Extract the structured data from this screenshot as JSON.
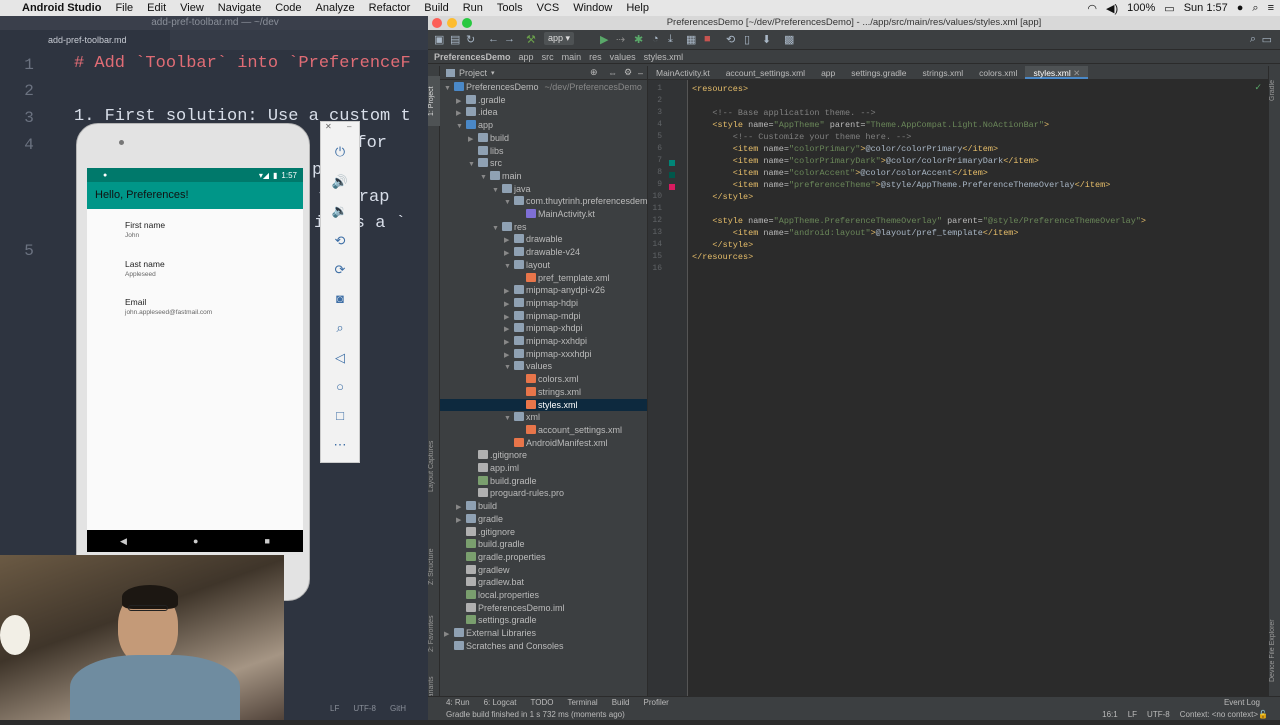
{
  "menubar": {
    "app_name": "Android Studio",
    "items": [
      "File",
      "Edit",
      "View",
      "Navigate",
      "Code",
      "Analyze",
      "Refactor",
      "Build",
      "Run",
      "Tools",
      "VCS",
      "Window",
      "Help"
    ],
    "battery": "100%",
    "clock": "Sun 1:57"
  },
  "md_editor": {
    "window_title": "add-pref-toolbar.md — ~/dev",
    "tab_label": "add-pref-toolbar.md",
    "lines": [
      {
        "num": "1",
        "text": "# Add `Toolbar` into `PreferenceF"
      },
      {
        "num": "2",
        "text": ""
      },
      {
        "num": "3",
        "text": "1. First solution: Use a custom t"
      },
      {
        "num": "4",
        "text": "a for"
      },
      {
        "num": "",
        "text": "p."
      },
      {
        "num": "",
        "text": "t: Wrap"
      },
      {
        "num": "",
        "text": "i has a `"
      },
      {
        "num": "5",
        "text": ""
      }
    ]
  },
  "emulator": {
    "status_time": "1:57",
    "app_title": "Hello, Preferences!",
    "prefs": [
      {
        "title": "First name",
        "summary": "John"
      },
      {
        "title": "Last name",
        "summary": "Appleseed"
      },
      {
        "title": "Email",
        "summary": "john.appleseed@fastmail.com"
      }
    ],
    "toolbar_icons": [
      "power-icon",
      "volume-up-icon",
      "volume-down-icon",
      "rotate-left-icon",
      "rotate-right-icon",
      "camera-icon",
      "zoom-icon",
      "back-icon",
      "home-icon",
      "overview-icon",
      "more-icon"
    ]
  },
  "studio": {
    "window_title": "PreferencesDemo [~/dev/PreferencesDemo] - .../app/src/main/res/values/styles.xml [app]",
    "run_config": "app",
    "breadcrumbs": [
      "PreferencesDemo",
      "app",
      "src",
      "main",
      "res",
      "values",
      "styles.xml"
    ],
    "project_view": "Project",
    "tree": [
      {
        "label": "PreferencesDemo",
        "hint": "~/dev/PreferencesDemo",
        "depth": 0,
        "arrow": "▼",
        "icon": "module"
      },
      {
        "label": ".gradle",
        "depth": 1,
        "arrow": "▶",
        "icon": "folder"
      },
      {
        "label": ".idea",
        "depth": 1,
        "arrow": "▶",
        "icon": "folder"
      },
      {
        "label": "app",
        "depth": 1,
        "arrow": "▼",
        "icon": "module"
      },
      {
        "label": "build",
        "depth": 2,
        "arrow": "▶",
        "icon": "folder"
      },
      {
        "label": "libs",
        "depth": 2,
        "arrow": "",
        "icon": "folder"
      },
      {
        "label": "src",
        "depth": 2,
        "arrow": "▼",
        "icon": "folder"
      },
      {
        "label": "main",
        "depth": 3,
        "arrow": "▼",
        "icon": "folder"
      },
      {
        "label": "java",
        "depth": 4,
        "arrow": "▼",
        "icon": "folder"
      },
      {
        "label": "com.thuytrinh.preferencesdem",
        "depth": 5,
        "arrow": "▼",
        "icon": "folder"
      },
      {
        "label": "MainActivity.kt",
        "depth": 6,
        "arrow": "",
        "icon": "kt"
      },
      {
        "label": "res",
        "depth": 4,
        "arrow": "▼",
        "icon": "folder"
      },
      {
        "label": "drawable",
        "depth": 5,
        "arrow": "▶",
        "icon": "folder"
      },
      {
        "label": "drawable-v24",
        "depth": 5,
        "arrow": "▶",
        "icon": "folder"
      },
      {
        "label": "layout",
        "depth": 5,
        "arrow": "▼",
        "icon": "folder"
      },
      {
        "label": "pref_template.xml",
        "depth": 6,
        "arrow": "",
        "icon": "xml"
      },
      {
        "label": "mipmap-anydpi-v26",
        "depth": 5,
        "arrow": "▶",
        "icon": "folder"
      },
      {
        "label": "mipmap-hdpi",
        "depth": 5,
        "arrow": "▶",
        "icon": "folder"
      },
      {
        "label": "mipmap-mdpi",
        "depth": 5,
        "arrow": "▶",
        "icon": "folder"
      },
      {
        "label": "mipmap-xhdpi",
        "depth": 5,
        "arrow": "▶",
        "icon": "folder"
      },
      {
        "label": "mipmap-xxhdpi",
        "depth": 5,
        "arrow": "▶",
        "icon": "folder"
      },
      {
        "label": "mipmap-xxxhdpi",
        "depth": 5,
        "arrow": "▶",
        "icon": "folder"
      },
      {
        "label": "values",
        "depth": 5,
        "arrow": "▼",
        "icon": "folder"
      },
      {
        "label": "colors.xml",
        "depth": 6,
        "arrow": "",
        "icon": "xml"
      },
      {
        "label": "strings.xml",
        "depth": 6,
        "arrow": "",
        "icon": "xml"
      },
      {
        "label": "styles.xml",
        "depth": 6,
        "arrow": "",
        "icon": "xml",
        "selected": true
      },
      {
        "label": "xml",
        "depth": 5,
        "arrow": "▼",
        "icon": "folder"
      },
      {
        "label": "account_settings.xml",
        "depth": 6,
        "arrow": "",
        "icon": "xml"
      },
      {
        "label": "AndroidManifest.xml",
        "depth": 5,
        "arrow": "",
        "icon": "xml"
      },
      {
        "label": ".gitignore",
        "depth": 2,
        "arrow": "",
        "icon": "file"
      },
      {
        "label": "app.iml",
        "depth": 2,
        "arrow": "",
        "icon": "file"
      },
      {
        "label": "build.gradle",
        "depth": 2,
        "arrow": "",
        "icon": "gradle"
      },
      {
        "label": "proguard-rules.pro",
        "depth": 2,
        "arrow": "",
        "icon": "file"
      },
      {
        "label": "build",
        "depth": 1,
        "arrow": "▶",
        "icon": "folder"
      },
      {
        "label": "gradle",
        "depth": 1,
        "arrow": "▶",
        "icon": "folder"
      },
      {
        "label": ".gitignore",
        "depth": 1,
        "arrow": "",
        "icon": "file"
      },
      {
        "label": "build.gradle",
        "depth": 1,
        "arrow": "",
        "icon": "gradle"
      },
      {
        "label": "gradle.properties",
        "depth": 1,
        "arrow": "",
        "icon": "gradle"
      },
      {
        "label": "gradlew",
        "depth": 1,
        "arrow": "",
        "icon": "file"
      },
      {
        "label": "gradlew.bat",
        "depth": 1,
        "arrow": "",
        "icon": "file"
      },
      {
        "label": "local.properties",
        "depth": 1,
        "arrow": "",
        "icon": "gradle"
      },
      {
        "label": "PreferencesDemo.iml",
        "depth": 1,
        "arrow": "",
        "icon": "file"
      },
      {
        "label": "settings.gradle",
        "depth": 1,
        "arrow": "",
        "icon": "gradle"
      },
      {
        "label": "External Libraries",
        "depth": 0,
        "arrow": "▶",
        "icon": "folder"
      },
      {
        "label": "Scratches and Consoles",
        "depth": 0,
        "arrow": "",
        "icon": "folder"
      }
    ],
    "editor_tabs": [
      {
        "label": "MainActivity.kt"
      },
      {
        "label": "account_settings.xml"
      },
      {
        "label": "app"
      },
      {
        "label": "settings.gradle"
      },
      {
        "label": "strings.xml"
      },
      {
        "label": "colors.xml"
      },
      {
        "label": "styles.xml",
        "active": true
      }
    ],
    "code": [
      {
        "n": "1",
        "parts": [
          [
            "tag",
            "<resources>"
          ]
        ]
      },
      {
        "n": "2",
        "parts": []
      },
      {
        "n": "3",
        "parts": [
          [
            "cmt",
            "    <!-- Base application theme. -->"
          ]
        ]
      },
      {
        "n": "4",
        "parts": [
          [
            "tag",
            "    <style "
          ],
          [
            "attr",
            "name="
          ],
          [
            "val",
            "\"AppTheme\" "
          ],
          [
            "attr",
            "parent="
          ],
          [
            "val",
            "\"Theme.AppCompat.Light.NoActionBar\""
          ],
          [
            "tag",
            ">"
          ]
        ]
      },
      {
        "n": "5",
        "parts": [
          [
            "cmt",
            "        <!-- Customize your theme here. -->"
          ]
        ]
      },
      {
        "n": "6",
        "parts": [
          [
            "tag",
            "        <item "
          ],
          [
            "attr",
            "name="
          ],
          [
            "val",
            "\"colorPrimary\""
          ],
          [
            "tag",
            ">"
          ],
          [
            "txt",
            "@color/colorPrimary"
          ],
          [
            "tag",
            "</item>"
          ]
        ]
      },
      {
        "n": "7",
        "parts": [
          [
            "tag",
            "        <item "
          ],
          [
            "attr",
            "name="
          ],
          [
            "val",
            "\"colorPrimaryDark\""
          ],
          [
            "tag",
            ">"
          ],
          [
            "txt",
            "@color/colorPrimaryDark"
          ],
          [
            "tag",
            "</item>"
          ]
        ]
      },
      {
        "n": "8",
        "parts": [
          [
            "tag",
            "        <item "
          ],
          [
            "attr",
            "name="
          ],
          [
            "val",
            "\"colorAccent\""
          ],
          [
            "tag",
            ">"
          ],
          [
            "txt",
            "@color/colorAccent"
          ],
          [
            "tag",
            "</item>"
          ]
        ]
      },
      {
        "n": "9",
        "parts": [
          [
            "tag",
            "        <item "
          ],
          [
            "attr",
            "name="
          ],
          [
            "val",
            "\"preferenceTheme\""
          ],
          [
            "tag",
            ">"
          ],
          [
            "txt",
            "@style/AppTheme.PreferenceThemeOverlay"
          ],
          [
            "tag",
            "</item>"
          ]
        ]
      },
      {
        "n": "10",
        "parts": [
          [
            "tag",
            "    </style>"
          ]
        ]
      },
      {
        "n": "11",
        "parts": []
      },
      {
        "n": "12",
        "parts": [
          [
            "tag",
            "    <style "
          ],
          [
            "attr",
            "name="
          ],
          [
            "val",
            "\"AppTheme.PreferenceThemeOverlay\" "
          ],
          [
            "attr",
            "parent="
          ],
          [
            "val",
            "\"@style/PreferenceThemeOverlay\""
          ],
          [
            "tag",
            ">"
          ]
        ]
      },
      {
        "n": "13",
        "parts": [
          [
            "tag",
            "        <item "
          ],
          [
            "attr",
            "name="
          ],
          [
            "val",
            "\"android:layout\""
          ],
          [
            "tag",
            ">"
          ],
          [
            "txt",
            "@layout/pref_template"
          ],
          [
            "tag",
            "</item>"
          ]
        ]
      },
      {
        "n": "14",
        "parts": [
          [
            "tag",
            "    </style>"
          ]
        ]
      },
      {
        "n": "15",
        "parts": [
          [
            "tag",
            "</resources>"
          ]
        ]
      },
      {
        "n": "16",
        "parts": []
      }
    ],
    "left_tool_tabs": [
      "1: Project",
      "Layout Captures",
      "Z: Structure",
      "2: Favorites",
      "Build Variants"
    ],
    "bottom_tabs": [
      "4: Run",
      "6: Logcat",
      "TODO",
      "Terminal",
      "Build",
      "Profiler"
    ],
    "event_log": "Event Log",
    "status_message": "Gradle build finished in 1 s 732 ms (moments ago)",
    "status_right": [
      "16:1",
      "LF",
      "UTF-8",
      "Context: <no context>"
    ],
    "right_tool_tab": "Device File Explorer",
    "md_status": [
      "LF",
      "UTF-8",
      "GitH"
    ]
  },
  "colors": {
    "accent": "#4a88c7",
    "app_bar": "#009688",
    "status_bar": "#00796b",
    "selection": "#0d293e"
  }
}
